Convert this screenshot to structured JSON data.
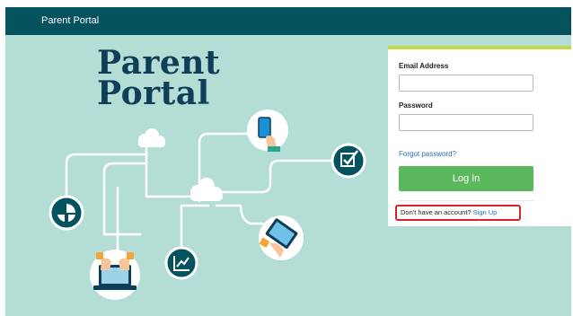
{
  "header": {
    "title": "Parent Portal"
  },
  "hero": {
    "title_line1": "Parent",
    "title_line2": "Portal"
  },
  "login": {
    "email_label": "Email Address",
    "email_value": "",
    "password_label": "Password",
    "password_value": "",
    "forgot_label": "Forgot password?",
    "login_label": "Log In",
    "no_account_text": "Don't have an account?",
    "signup_label": "Sign Up"
  },
  "colors": {
    "header_bg": "#05525f",
    "hero_bg": "#b3ddd5",
    "card_accent": "#c1d94b",
    "login_button": "#5cb85c",
    "highlight_border": "#d2262c",
    "link": "#2a6ebb"
  }
}
